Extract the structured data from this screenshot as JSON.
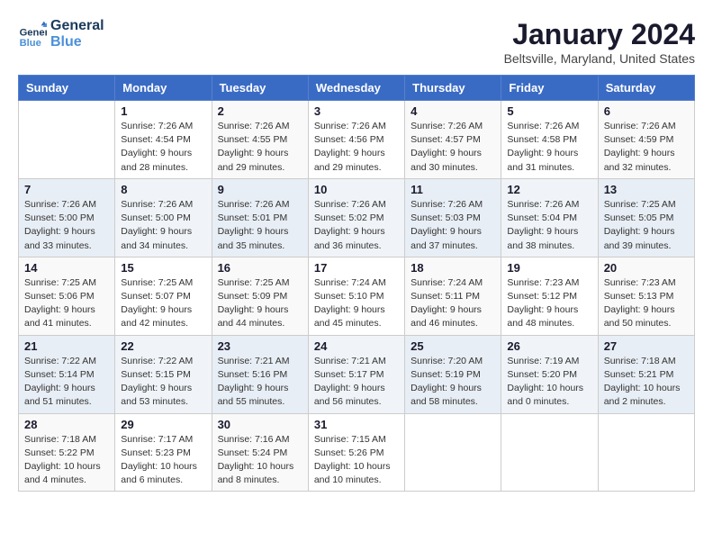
{
  "logo": {
    "line1": "General",
    "line2": "Blue"
  },
  "title": "January 2024",
  "subtitle": "Beltsville, Maryland, United States",
  "days_of_week": [
    "Sunday",
    "Monday",
    "Tuesday",
    "Wednesday",
    "Thursday",
    "Friday",
    "Saturday"
  ],
  "weeks": [
    [
      {
        "num": "",
        "info": ""
      },
      {
        "num": "1",
        "info": "Sunrise: 7:26 AM\nSunset: 4:54 PM\nDaylight: 9 hours\nand 28 minutes."
      },
      {
        "num": "2",
        "info": "Sunrise: 7:26 AM\nSunset: 4:55 PM\nDaylight: 9 hours\nand 29 minutes."
      },
      {
        "num": "3",
        "info": "Sunrise: 7:26 AM\nSunset: 4:56 PM\nDaylight: 9 hours\nand 29 minutes."
      },
      {
        "num": "4",
        "info": "Sunrise: 7:26 AM\nSunset: 4:57 PM\nDaylight: 9 hours\nand 30 minutes."
      },
      {
        "num": "5",
        "info": "Sunrise: 7:26 AM\nSunset: 4:58 PM\nDaylight: 9 hours\nand 31 minutes."
      },
      {
        "num": "6",
        "info": "Sunrise: 7:26 AM\nSunset: 4:59 PM\nDaylight: 9 hours\nand 32 minutes."
      }
    ],
    [
      {
        "num": "7",
        "info": "Sunrise: 7:26 AM\nSunset: 5:00 PM\nDaylight: 9 hours\nand 33 minutes."
      },
      {
        "num": "8",
        "info": "Sunrise: 7:26 AM\nSunset: 5:00 PM\nDaylight: 9 hours\nand 34 minutes."
      },
      {
        "num": "9",
        "info": "Sunrise: 7:26 AM\nSunset: 5:01 PM\nDaylight: 9 hours\nand 35 minutes."
      },
      {
        "num": "10",
        "info": "Sunrise: 7:26 AM\nSunset: 5:02 PM\nDaylight: 9 hours\nand 36 minutes."
      },
      {
        "num": "11",
        "info": "Sunrise: 7:26 AM\nSunset: 5:03 PM\nDaylight: 9 hours\nand 37 minutes."
      },
      {
        "num": "12",
        "info": "Sunrise: 7:26 AM\nSunset: 5:04 PM\nDaylight: 9 hours\nand 38 minutes."
      },
      {
        "num": "13",
        "info": "Sunrise: 7:25 AM\nSunset: 5:05 PM\nDaylight: 9 hours\nand 39 minutes."
      }
    ],
    [
      {
        "num": "14",
        "info": "Sunrise: 7:25 AM\nSunset: 5:06 PM\nDaylight: 9 hours\nand 41 minutes."
      },
      {
        "num": "15",
        "info": "Sunrise: 7:25 AM\nSunset: 5:07 PM\nDaylight: 9 hours\nand 42 minutes."
      },
      {
        "num": "16",
        "info": "Sunrise: 7:25 AM\nSunset: 5:09 PM\nDaylight: 9 hours\nand 44 minutes."
      },
      {
        "num": "17",
        "info": "Sunrise: 7:24 AM\nSunset: 5:10 PM\nDaylight: 9 hours\nand 45 minutes."
      },
      {
        "num": "18",
        "info": "Sunrise: 7:24 AM\nSunset: 5:11 PM\nDaylight: 9 hours\nand 46 minutes."
      },
      {
        "num": "19",
        "info": "Sunrise: 7:23 AM\nSunset: 5:12 PM\nDaylight: 9 hours\nand 48 minutes."
      },
      {
        "num": "20",
        "info": "Sunrise: 7:23 AM\nSunset: 5:13 PM\nDaylight: 9 hours\nand 50 minutes."
      }
    ],
    [
      {
        "num": "21",
        "info": "Sunrise: 7:22 AM\nSunset: 5:14 PM\nDaylight: 9 hours\nand 51 minutes."
      },
      {
        "num": "22",
        "info": "Sunrise: 7:22 AM\nSunset: 5:15 PM\nDaylight: 9 hours\nand 53 minutes."
      },
      {
        "num": "23",
        "info": "Sunrise: 7:21 AM\nSunset: 5:16 PM\nDaylight: 9 hours\nand 55 minutes."
      },
      {
        "num": "24",
        "info": "Sunrise: 7:21 AM\nSunset: 5:17 PM\nDaylight: 9 hours\nand 56 minutes."
      },
      {
        "num": "25",
        "info": "Sunrise: 7:20 AM\nSunset: 5:19 PM\nDaylight: 9 hours\nand 58 minutes."
      },
      {
        "num": "26",
        "info": "Sunrise: 7:19 AM\nSunset: 5:20 PM\nDaylight: 10 hours\nand 0 minutes."
      },
      {
        "num": "27",
        "info": "Sunrise: 7:18 AM\nSunset: 5:21 PM\nDaylight: 10 hours\nand 2 minutes."
      }
    ],
    [
      {
        "num": "28",
        "info": "Sunrise: 7:18 AM\nSunset: 5:22 PM\nDaylight: 10 hours\nand 4 minutes."
      },
      {
        "num": "29",
        "info": "Sunrise: 7:17 AM\nSunset: 5:23 PM\nDaylight: 10 hours\nand 6 minutes."
      },
      {
        "num": "30",
        "info": "Sunrise: 7:16 AM\nSunset: 5:24 PM\nDaylight: 10 hours\nand 8 minutes."
      },
      {
        "num": "31",
        "info": "Sunrise: 7:15 AM\nSunset: 5:26 PM\nDaylight: 10 hours\nand 10 minutes."
      },
      {
        "num": "",
        "info": ""
      },
      {
        "num": "",
        "info": ""
      },
      {
        "num": "",
        "info": ""
      }
    ]
  ]
}
